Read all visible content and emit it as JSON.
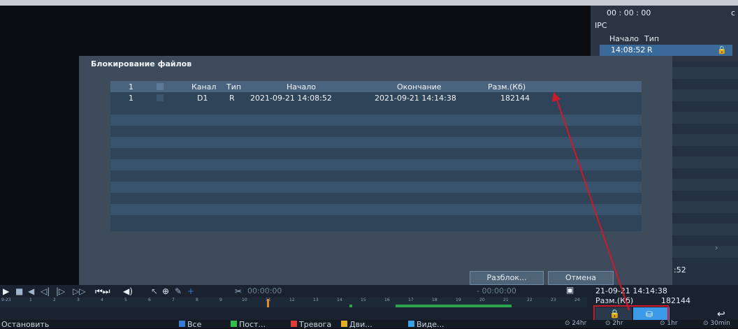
{
  "time_panel": {
    "time": "00 : 00 : 00",
    "partial": "c",
    "ipc": "IPC",
    "col_start": "Начало",
    "col_type": "Тип",
    "row_time": "14:08:52",
    "row_type": "R"
  },
  "dialog": {
    "title": "Блокирование файлов",
    "headers": {
      "num": "1",
      "channel": "Канал",
      "type": "Тип",
      "start": "Начало",
      "end": "Окончание",
      "size": "Разм.(Кб)"
    },
    "rows": [
      {
        "num": "1",
        "channel": "D1",
        "type": "R",
        "start": "2021-09-21 14:08:52",
        "end": "2021-09-21 14:14:38",
        "size": "182144"
      }
    ],
    "unlock_label": "Разблок...",
    "cancel_label": "Отмена"
  },
  "right_info": {
    "time_partial": ":52",
    "date": "21-09-21 14:14:38",
    "size_label": "Разм.(Кб)",
    "size_value": "182144"
  },
  "playback": {
    "clip_start": "00:00:00",
    "clip_end": "- 00:00:00",
    "ticks": [
      "9-23",
      "1",
      "2",
      "3",
      "4",
      "5",
      "6",
      "7",
      "8",
      "9",
      "10",
      "11",
      "12",
      "13",
      "14",
      "15",
      "16",
      "17",
      "18",
      "19",
      "20",
      "21",
      "22",
      "23",
      "24"
    ]
  },
  "status": {
    "stop_label": "Остановить",
    "legend": [
      {
        "label": "Все",
        "color": "#3a7bd5"
      },
      {
        "label": "Пост...",
        "color": "#2fbf4a"
      },
      {
        "label": "Тревога",
        "color": "#e03a3a"
      },
      {
        "label": "Дви...",
        "color": "#e0b020"
      },
      {
        "label": "Виде...",
        "color": "#3aa0e0"
      }
    ],
    "time_filters": [
      "24hr",
      "2hr",
      "1hr",
      "30min"
    ]
  },
  "colors": {
    "highlight": "#d0182a",
    "accent": "#3a7bd5"
  }
}
